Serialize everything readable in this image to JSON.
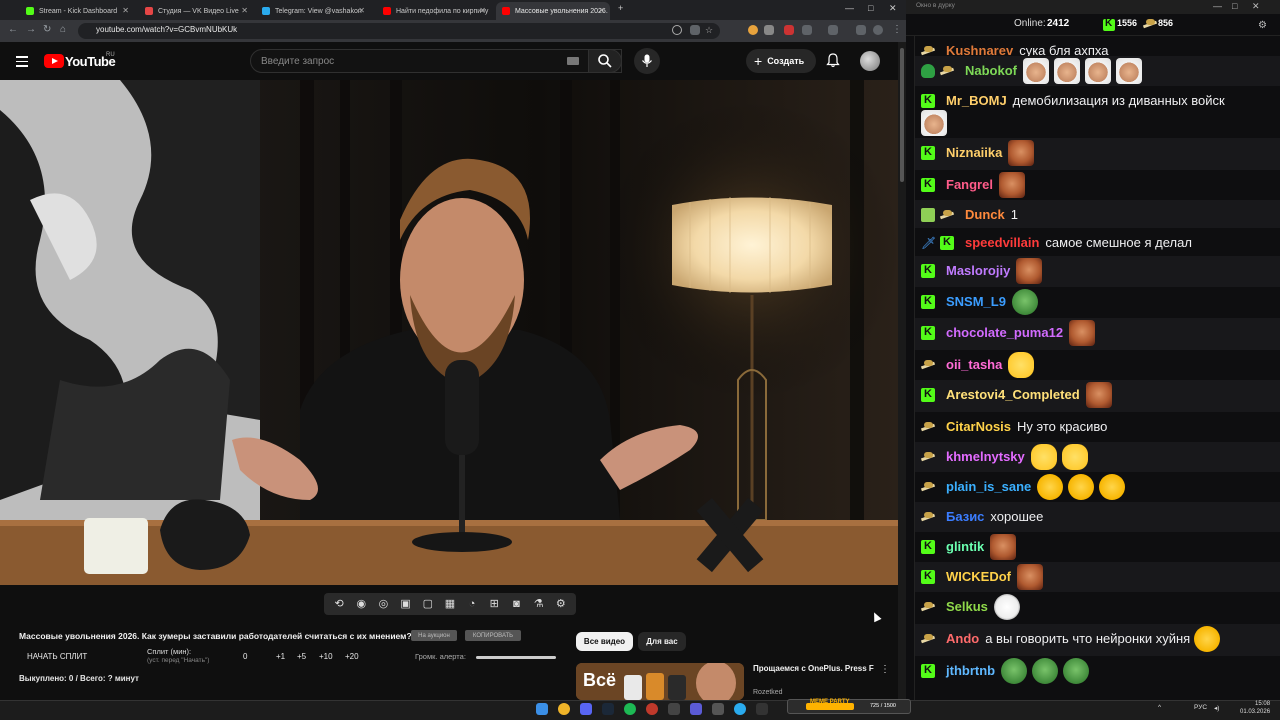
{
  "browser": {
    "tabs": [
      {
        "title": "Stream - Kick Dashboard",
        "color": "#53fc18"
      },
      {
        "title": "Студия — VK Видео Live",
        "color": "#e64646"
      },
      {
        "title": "Telegram: View @vashakon",
        "color": "#2aabee"
      },
      {
        "title": "Найти педофила по кирпичу",
        "color": "#ff0000"
      },
      {
        "title": "Массовые увольнения 2026. К",
        "color": "#ff0000"
      }
    ],
    "url": "youtube.com/watch?v=GCBvmNUbKUk"
  },
  "youtube": {
    "logo": "YouTube",
    "region": "RU",
    "search_placeholder": "Введите запрос",
    "create_label": "Создать"
  },
  "video": {
    "title": "Массовые увольнения 2026. Как зумеры заставили работодателей считаться с их мнением?",
    "btn_auction": "На аукцион",
    "btn_copy": "КОПИРОВАТЬ",
    "start_split": "НАЧАТЬ СПЛИТ",
    "split_label": "Сплит (мин):",
    "split_hint": "(уст. перед \"Начать\")",
    "split_value": "0",
    "split_steps": [
      "+1",
      "+5",
      "+10",
      "+20"
    ],
    "alert_volume_label": "Громк. алерта:",
    "summary": "Выкуплено: 0 / Всего: ? минут"
  },
  "recommendations": {
    "chips": [
      "Все видео",
      "Для вас"
    ],
    "item_title": "Прощаемся с OnePlus. Press F",
    "item_channel": "Rozetked",
    "thumb_text": "Всё"
  },
  "chat": {
    "window_title": "Окно в дурку",
    "online_label": "Online:",
    "online_count": "2412",
    "kick_count": "1556",
    "coin_count": "856",
    "messages": [
      {
        "user": "Kushnarev",
        "color": "#e07a3a",
        "badges": [
          "cig"
        ],
        "text": "сука бля ахпха",
        "emotes": []
      },
      {
        "user": "Nabokof",
        "color": "#7ed957",
        "badges": [
          "shield",
          "cig"
        ],
        "text": "",
        "emotes": [
          "man",
          "man",
          "man",
          "man"
        ]
      },
      {
        "user": "Mr_BOMJ",
        "color": "#ffcf6b",
        "badges": [
          "kick"
        ],
        "text": "демобилизация из диванных войск",
        "emotes": []
      },
      {
        "user": "Niznaiika",
        "color": "#ffcf6b",
        "badges": [
          "kick"
        ],
        "text": "",
        "emotes": [
          "face"
        ]
      },
      {
        "user": "Fangrel",
        "color": "#ff5c8a",
        "badges": [
          "kick"
        ],
        "text": "",
        "emotes": [
          "face"
        ]
      },
      {
        "user": "Dunck",
        "color": "#ff8a3d",
        "badges": [
          "pencil",
          "cig"
        ],
        "text": "1",
        "emotes": []
      },
      {
        "user": "speedvillain",
        "color": "#ff3b3b",
        "badges": [
          "sword",
          "kick"
        ],
        "text": "самое смешное я делал",
        "emotes": []
      },
      {
        "user": "Maslorojiy",
        "color": "#c07bff",
        "badges": [
          "kick"
        ],
        "text": "",
        "emotes": [
          "face"
        ]
      },
      {
        "user": "SNSM_L9",
        "color": "#3b9dff",
        "badges": [
          "kick"
        ],
        "text": "",
        "emotes": [
          "pepe"
        ]
      },
      {
        "user": "chocolate_puma12",
        "color": "#d26bff",
        "badges": [
          "kick"
        ],
        "text": "",
        "emotes": [
          "face"
        ]
      },
      {
        "user": "oii_tasha",
        "color": "#ff6bd6",
        "badges": [
          "cig"
        ],
        "text": "",
        "emotes": [
          "glasses"
        ]
      },
      {
        "user": "Arestovi4_Completed",
        "color": "#ffe07a",
        "badges": [
          "kick"
        ],
        "text": "",
        "emotes": [
          "face"
        ]
      },
      {
        "user": "CitarNosis",
        "color": "#ffd24a",
        "badges": [
          "cig"
        ],
        "text": "Ну это красиво",
        "emotes": []
      },
      {
        "user": "khmelnytsky",
        "color": "#e36bff",
        "badges": [
          "cig"
        ],
        "text": "",
        "emotes": [
          "glasses",
          "glasses"
        ]
      },
      {
        "user": "plain_is_sane",
        "color": "#3bb0ff",
        "badges": [
          "cig"
        ],
        "text": "",
        "emotes": [
          "cry",
          "cry",
          "cry"
        ]
      },
      {
        "user": "Базис",
        "color": "#3b7dff",
        "badges": [
          "cig"
        ],
        "text": "хорошее",
        "emotes": []
      },
      {
        "user": "glintik",
        "color": "#6bffb0",
        "badges": [
          "kick"
        ],
        "text": "",
        "emotes": [
          "face"
        ]
      },
      {
        "user": "WICKEDof",
        "color": "#ffd24a",
        "badges": [
          "kick"
        ],
        "text": "",
        "emotes": [
          "face"
        ]
      },
      {
        "user": "Selkus",
        "color": "#8fd94a",
        "badges": [
          "cig"
        ],
        "text": "",
        "emotes": [
          "joke"
        ]
      },
      {
        "user": "Ando",
        "color": "#ff6b6b",
        "badges": [
          "cig"
        ],
        "text": "а вы говорить что нейронки хуйня",
        "emotes": [
          "cry"
        ]
      },
      {
        "user": "jthbrtnb",
        "color": "#5fb8ff",
        "badges": [
          "kick"
        ],
        "text": "",
        "emotes": [
          "pepe",
          "pepe",
          "pepe"
        ]
      }
    ]
  },
  "taskbar": {
    "meme_label": "MEME PARTY",
    "meme_count": "725 / 1500",
    "meme_progress": 0.48,
    "lang": "РУС",
    "time": "15:08",
    "date": "01.03.2026"
  }
}
